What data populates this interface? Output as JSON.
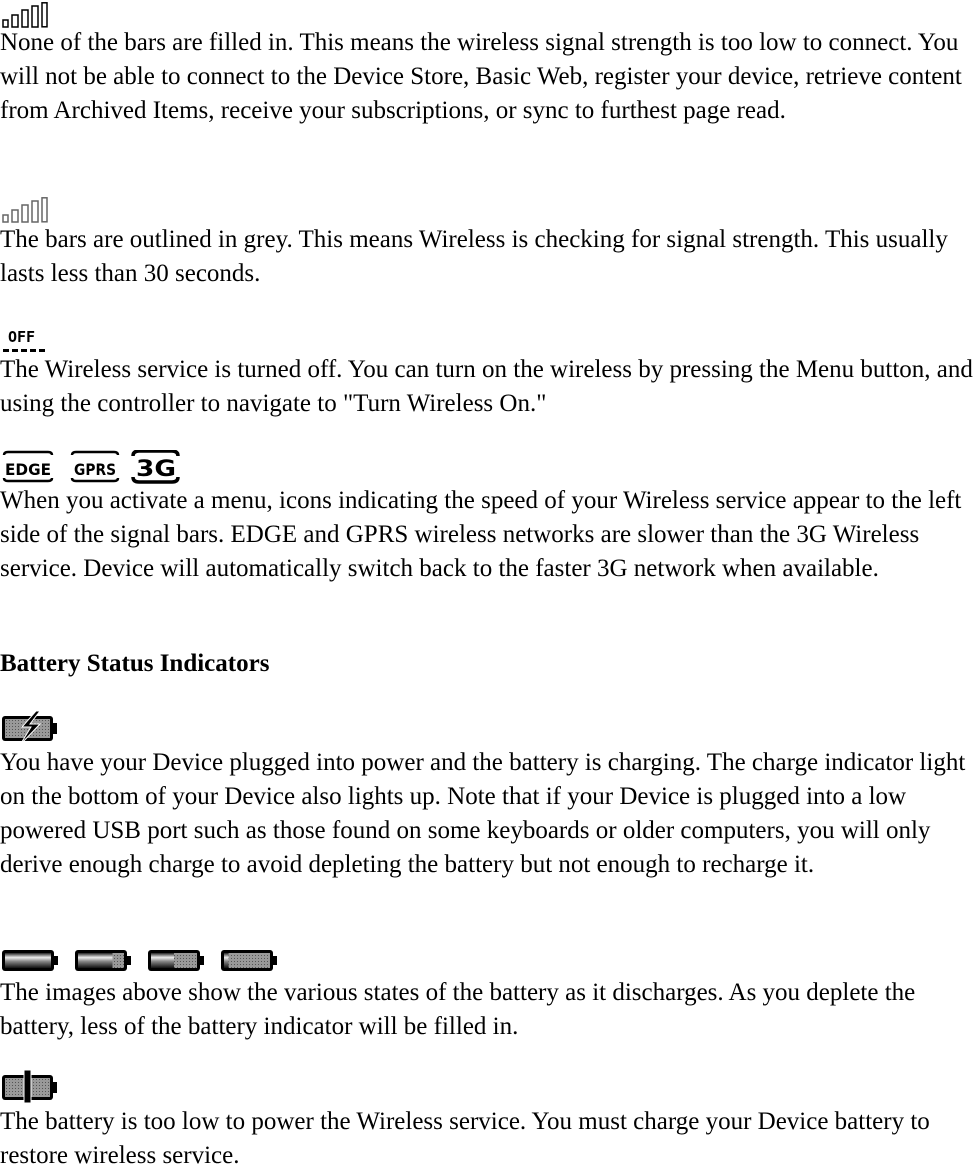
{
  "signal_section": {
    "no_signal": {
      "icon": "signal-bars-empty-icon",
      "text": "None of the bars are filled in. This means the wireless signal strength is too low to connect. You will not be able to connect to the Device Store, Basic Web, register your device, retrieve content from Archived Items, receive your subscriptions, or sync to furthest page read."
    },
    "checking": {
      "icon": "signal-bars-grey-icon",
      "text": "The bars are outlined in grey. This means Wireless is checking for signal strength. This usually lasts less than 30 seconds."
    },
    "off": {
      "icon": "wireless-off-icon",
      "icon_label": "OFF",
      "text": "The Wireless service is turned off. You can turn on the wireless by pressing the Menu button, and using the controller to navigate to \"Turn Wireless On.\""
    },
    "speed": {
      "icons": [
        {
          "name": "edge-icon",
          "label": "EDGE"
        },
        {
          "name": "gprs-icon",
          "label": "GPRS"
        },
        {
          "name": "3g-icon",
          "label": "3G"
        }
      ],
      "text": "When you activate a menu, icons indicating the speed of your Wireless service appear to the left side of the signal bars. EDGE and GPRS wireless networks are slower than the 3G Wireless service. Device will automatically switch back to the faster 3G network when available."
    }
  },
  "battery_section": {
    "heading": "Battery Status Indicators",
    "charging": {
      "icon": "battery-charging-icon",
      "text": "You have your Device plugged into power and the battery is charging. The charge indicator light on the bottom of your Device also lights up. Note that if your Device is plugged into a low powered USB port such as those found on some keyboards or older computers, you will only derive enough charge to avoid depleting the battery but not enough to recharge it."
    },
    "levels": {
      "icons": [
        {
          "name": "battery-full-icon",
          "level": 1.0
        },
        {
          "name": "battery-three-quarter-icon",
          "level": 0.75
        },
        {
          "name": "battery-half-icon",
          "level": 0.5
        },
        {
          "name": "battery-low-icon",
          "level": 0.1
        }
      ],
      "text": "The images above show the various states of the battery as it discharges. As you deplete the battery, less of the battery indicator will be filled in."
    },
    "too_low": {
      "icon": "battery-too-low-icon",
      "text": "The battery is too low to power the Wireless service. You must charge your Device battery to restore wireless service."
    }
  }
}
